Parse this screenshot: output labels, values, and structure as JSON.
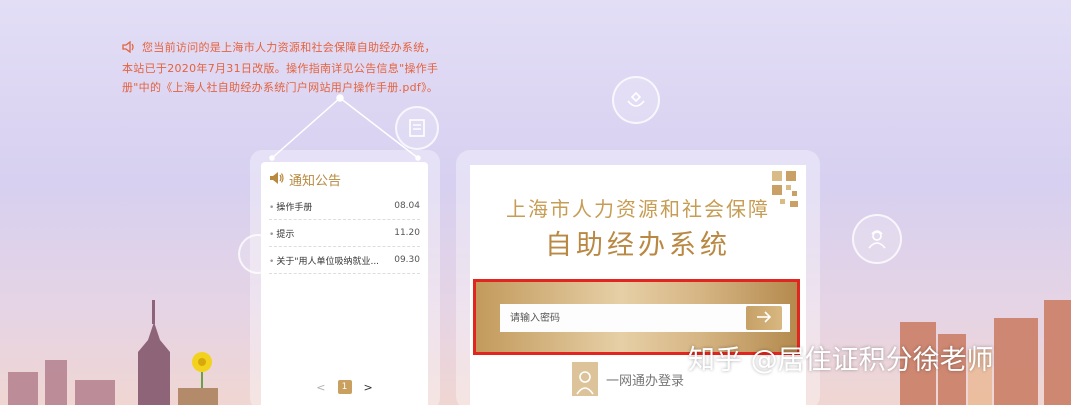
{
  "notice": {
    "text": "您当前访问的是上海市人力资源和社会保障自助经办系统，本站已于2020年7月31日改版。操作指南详见公告信息\"操作手册\"中的《上海人社自助经办系统门户网站用户操作手册.pdf》。",
    "icon": "speaker-icon"
  },
  "notice_panel": {
    "title": "通知公告",
    "items": [
      {
        "title": "操作手册",
        "date": "08.04"
      },
      {
        "title": "提示",
        "date": "11.20"
      },
      {
        "title": "关于\"用人单位吸纳就业...",
        "date": "09.30"
      }
    ],
    "pager": {
      "prev": "<",
      "current": "1",
      "next": ">"
    }
  },
  "login": {
    "title_line1": "上海市人力资源和社会保障",
    "title_line2": "自助经办系统",
    "password_placeholder": "请输入密码",
    "one_net_label": "一网通办登录"
  },
  "watermark": "知乎 @居住证积分徐老师",
  "colors": {
    "gold": "#c79d55",
    "highlight_red": "#e2261f",
    "notice_orange": "#e4623e"
  }
}
